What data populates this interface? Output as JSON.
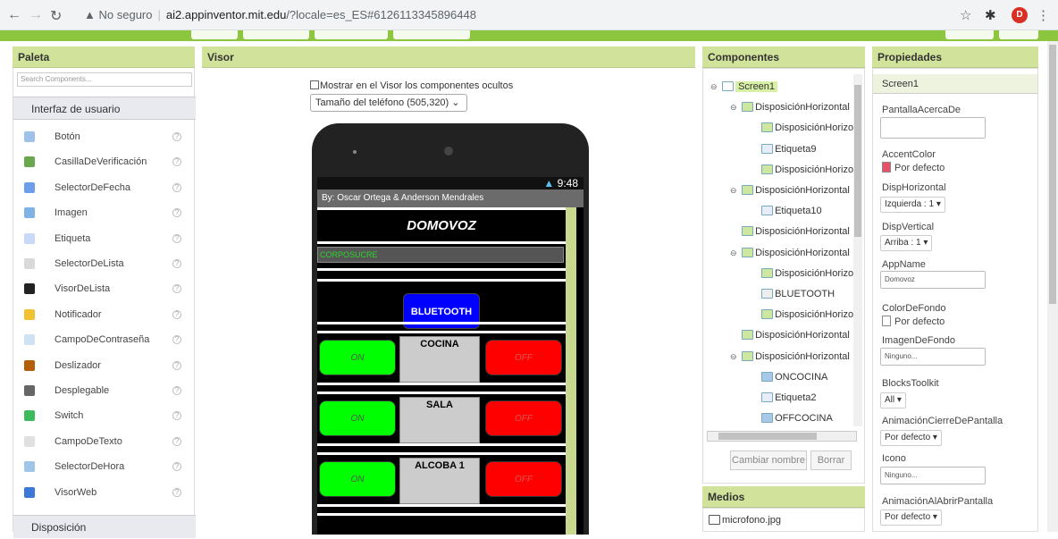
{
  "browser": {
    "back_icon": "arrow-left-icon",
    "forward_icon": "arrow-right-icon",
    "reload_icon": "reload-icon",
    "security_label": "No seguro",
    "url_host": "ai2.appinventor.mit.edu",
    "url_path": "/?locale=es_ES#6126113345896448",
    "avatar_letter": "D"
  },
  "palette": {
    "header": "Paleta",
    "search_placeholder": "Search Components...",
    "category": "Interfaz de usuario",
    "help_glyph": "?",
    "items": [
      {
        "label": "Botón",
        "color": "#9fc3e8"
      },
      {
        "label": "CasillaDeVerificación",
        "color": "#6aa84f"
      },
      {
        "label": "SelectorDeFecha",
        "color": "#6d9eeb"
      },
      {
        "label": "Imagen",
        "color": "#7fb2e5"
      },
      {
        "label": "Etiqueta",
        "color": "#c9daf8"
      },
      {
        "label": "SelectorDeLista",
        "color": "#d9d9d9"
      },
      {
        "label": "VisorDeLista",
        "color": "#222222"
      },
      {
        "label": "Notificador",
        "color": "#f1c232"
      },
      {
        "label": "CampoDeContraseña",
        "color": "#cfe2f3"
      },
      {
        "label": "Deslizador",
        "color": "#b45f06"
      },
      {
        "label": "Desplegable",
        "color": "#666666"
      },
      {
        "label": "Switch",
        "color": "#3dbb5c"
      },
      {
        "label": "CampoDeTexto",
        "color": "#e0e0e0"
      },
      {
        "label": "SelectorDeHora",
        "color": "#9fc5e8"
      },
      {
        "label": "VisorWeb",
        "color": "#3c78d8"
      }
    ],
    "category2": "Disposición"
  },
  "visor": {
    "header": "Visor",
    "show_hidden_label": "Mostrar en el Visor los componentes ocultos",
    "phone_size": "Tamaño del teléfono (505,320)",
    "phone": {
      "status_text": "9:48",
      "title": "By: Oscar Ortega & Anderson Mendrales",
      "app_title": "DOMOVOZ",
      "corp_label": "CORPOSUCRE",
      "bluetooth_label": "BLUETOOTH",
      "on_label": "ON",
      "off_label": "OFF",
      "rooms": [
        "COCINA",
        "SALA",
        "ALCOBA 1"
      ]
    }
  },
  "components": {
    "header": "Componentes",
    "tree": [
      {
        "label": "Screen1",
        "toggle": "⊖",
        "icon": "screen"
      },
      {
        "label": "DisposiciónHorizontal",
        "toggle": "⊖",
        "icon": "layout"
      },
      {
        "label": "DisposiciónHorizon",
        "toggle": "",
        "icon": "layout"
      },
      {
        "label": "Etiqueta9",
        "toggle": "",
        "icon": "label"
      },
      {
        "label": "DisposiciónHorizon",
        "toggle": "",
        "icon": "layout"
      },
      {
        "label": "DisposiciónHorizontal",
        "toggle": "⊖",
        "icon": "layout"
      },
      {
        "label": "Etiqueta10",
        "toggle": "",
        "icon": "label"
      },
      {
        "label": "DisposiciónHorizontal",
        "toggle": "",
        "icon": "layout"
      },
      {
        "label": "DisposiciónHorizontal",
        "toggle": "⊖",
        "icon": "layout"
      },
      {
        "label": "DisposiciónHorizon",
        "toggle": "",
        "icon": "layout"
      },
      {
        "label": "BLUETOOTH",
        "toggle": "",
        "icon": "listpicker"
      },
      {
        "label": "DisposiciónHorizon",
        "toggle": "",
        "icon": "layout"
      },
      {
        "label": "DisposiciónHorizontal",
        "toggle": "",
        "icon": "layout"
      },
      {
        "label": "DisposiciónHorizontal",
        "toggle": "⊖",
        "icon": "layout"
      },
      {
        "label": "ONCOCINA",
        "toggle": "",
        "icon": "button"
      },
      {
        "label": "Etiqueta2",
        "toggle": "",
        "icon": "label"
      },
      {
        "label": "OFFCOCINA",
        "toggle": "",
        "icon": "button"
      }
    ],
    "rename_button": "Cambiar nombre",
    "delete_button": "Borrar"
  },
  "media": {
    "header": "Medios",
    "items": [
      "microfono.jpg"
    ]
  },
  "properties": {
    "header": "Propiedades",
    "component": "Screen1",
    "about_label": "PantallaAcercaDe",
    "accent_label": "AccentColor",
    "accent_value": "Por defecto",
    "accent_color": "#e8516a",
    "halign_label": "DispHorizontal",
    "halign_value": "Izquierda : 1 ▾",
    "valign_label": "DispVertical",
    "valign_value": "Arriba : 1 ▾",
    "appname_label": "AppName",
    "appname_value": "Domovoz",
    "bgcolor_label": "ColorDeFondo",
    "bgcolor_value": "Por defecto",
    "bgimage_label": "ImagenDeFondo",
    "bgimage_value": "Ninguno...",
    "blocks_label": "BlocksToolkit",
    "blocks_value": "All ▾",
    "close_anim_label": "AnimaciónCierreDePantalla",
    "close_anim_value": "Por defecto ▾",
    "icon_label": "Icono",
    "icon_value": "Ninguno...",
    "open_anim_label": "AnimaciónAlAbrirPantalla",
    "open_anim_value": "Por defecto ▾"
  }
}
